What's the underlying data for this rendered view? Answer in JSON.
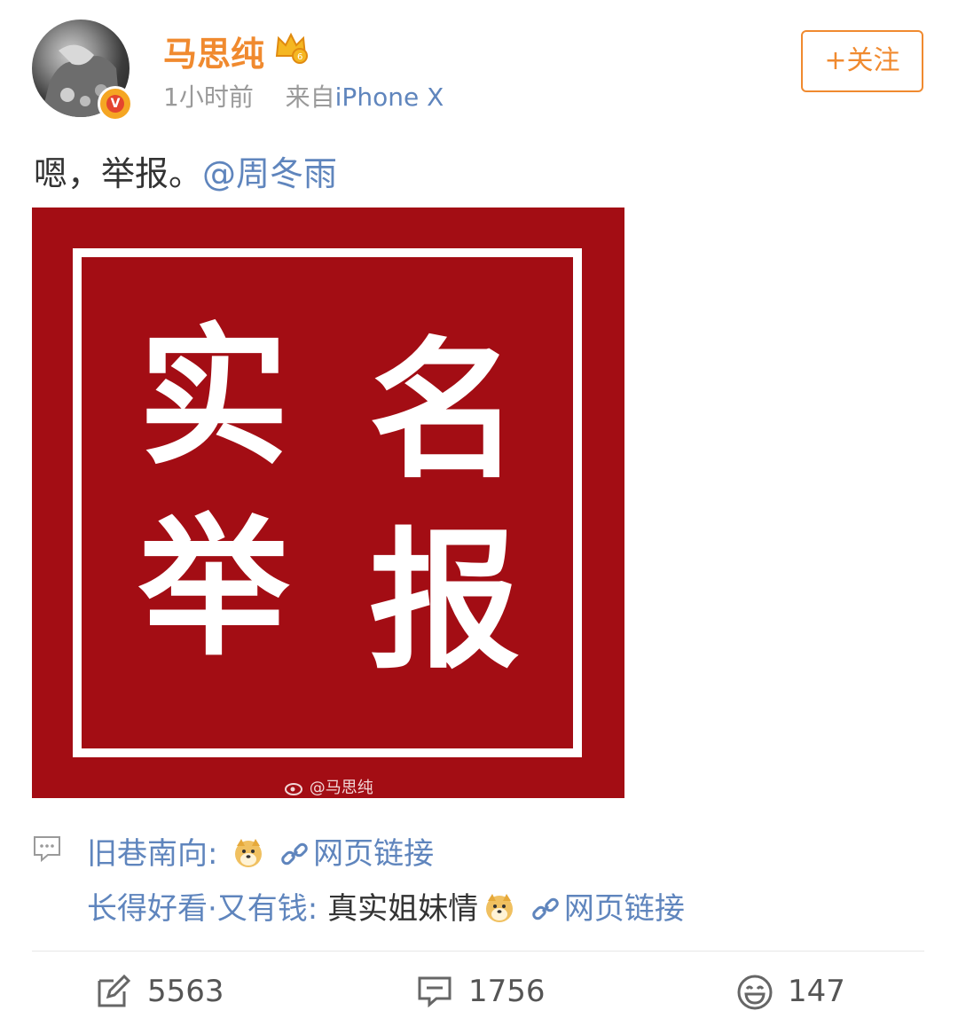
{
  "post": {
    "username": "马思纯",
    "time": "1小时前",
    "source_prefix": "来自",
    "source_device": "iPhone X",
    "follow_label": "+关注",
    "text_prefix": "嗯，举报。",
    "mention": "@周冬雨"
  },
  "image": {
    "chars": [
      "实",
      "名",
      "举",
      "报"
    ],
    "watermark": "@马思纯",
    "background_color": "#a30d14"
  },
  "comments": [
    {
      "author": "旧巷南向:",
      "text": "",
      "link": "网页链接"
    },
    {
      "author": "长得好看·又有钱:",
      "text": "真实姐妹情",
      "link": "网页链接"
    }
  ],
  "actions": {
    "repost_count": "5563",
    "comment_count": "1756",
    "like_count": "147"
  },
  "colors": {
    "username": "#f08a2f",
    "link": "#5f85bd",
    "meta": "#9a9a9a"
  }
}
